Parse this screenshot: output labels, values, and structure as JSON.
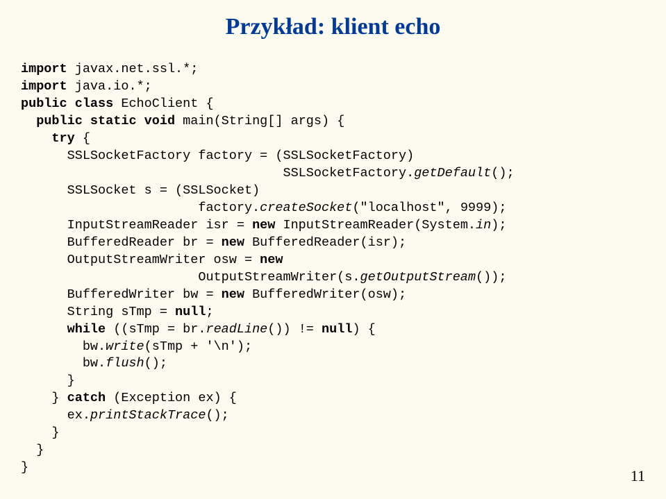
{
  "title": "Przykład: klient echo",
  "page_number": "11",
  "code": {
    "l1a": "import",
    "l1b": " javax.net.ssl.*;",
    "l2a": "import",
    "l2b": " java.io.*;",
    "l3a": "public class",
    "l3b": " EchoClient {",
    "l4a": "  ",
    "l4b": "public static void",
    "l4c": " main(String[] args) {",
    "l5a": "    ",
    "l5b": "try",
    "l5c": " {",
    "l6a": "      SSLSocketFactory factory = (SSLSocketFactory)",
    "l7a": "                                  SSLSocketFactory.",
    "l7b": "getDefault",
    "l7c": "();",
    "l8a": "      SSLSocket s = (SSLSocket)",
    "l9a": "                       factory.",
    "l9b": "createSocket",
    "l9c": "(\"localhost\", 9999);",
    "l10a": "      InputStreamReader isr = ",
    "l10b": "new",
    "l10c": " InputStreamReader(System.",
    "l10d": "in",
    "l10e": ");",
    "l11a": "      BufferedReader br = ",
    "l11b": "new",
    "l11c": " BufferedReader(isr);",
    "l12a": "      OutputStreamWriter osw = ",
    "l12b": "new",
    "l13a": "                       OutputStreamWriter(s.",
    "l13b": "getOutputStream",
    "l13c": "());",
    "l14a": "      BufferedWriter bw = ",
    "l14b": "new",
    "l14c": " BufferedWriter(osw);",
    "l15a": "      String sTmp = ",
    "l15b": "null",
    "l15c": ";",
    "l16a": "      ",
    "l16b": "while",
    "l16c": " ((sTmp = br.",
    "l16d": "readLine",
    "l16e": "()) != ",
    "l16f": "null",
    "l16g": ") {",
    "l17a": "        bw.",
    "l17b": "write",
    "l17c": "(sTmp + '\\n');",
    "l18a": "        bw.",
    "l18b": "flush",
    "l18c": "();",
    "l19a": "      }",
    "l20a": "    } ",
    "l20b": "catch",
    "l20c": " (Exception ex) {",
    "l21a": "      ex.",
    "l21b": "printStackTrace",
    "l21c": "();",
    "l22a": "    }",
    "l23a": "  }",
    "l24a": "}"
  }
}
